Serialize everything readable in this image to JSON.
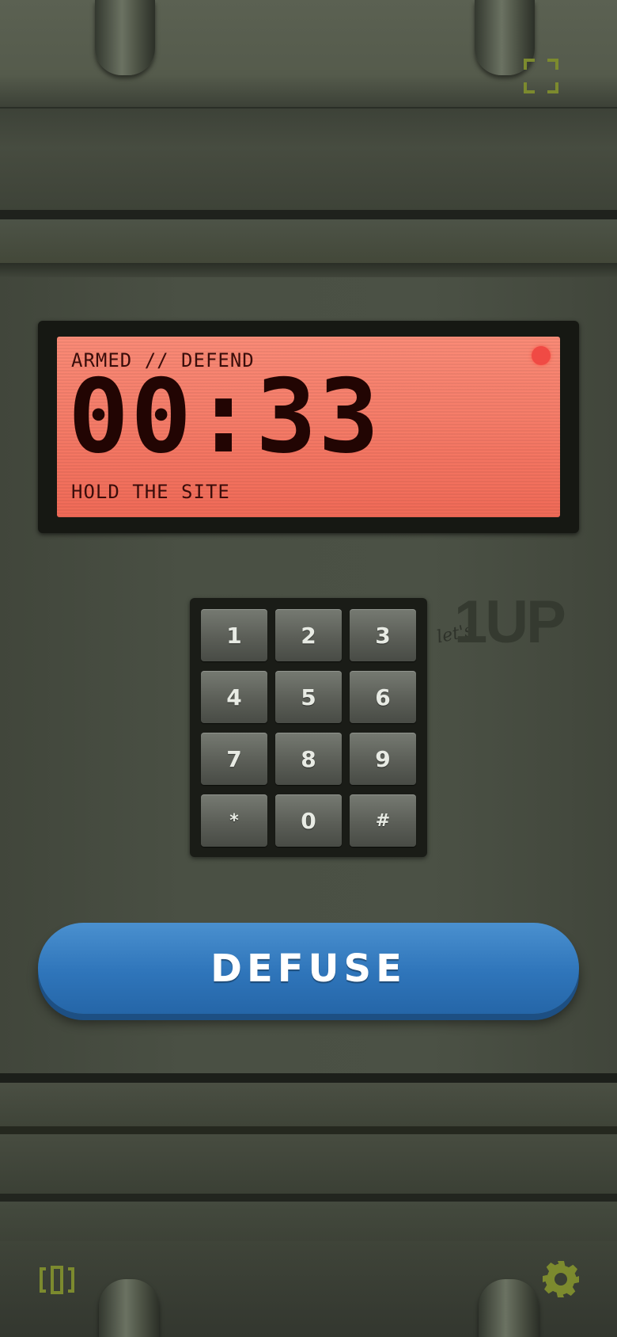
{
  "display": {
    "status": "ARMED // DEFEND",
    "timer": "00:33",
    "hint": "HOLD THE SITE"
  },
  "keypad": {
    "keys": [
      "1",
      "2",
      "3",
      "4",
      "5",
      "6",
      "7",
      "8",
      "9",
      "*",
      "0",
      "#"
    ]
  },
  "logo": {
    "small_text": "let's",
    "big_text": "1UP"
  },
  "actions": {
    "defuse_label": "DEFUSE"
  },
  "icons": {
    "top_right": "fullscreen-icon",
    "bottom_left": "bracket-timeline-icon",
    "bottom_right": "gear-icon"
  },
  "colors": {
    "lcd": "#f37a66",
    "defuse_button": "#2f75ba",
    "icon_accent": "#7c8a2e",
    "status_dot": "#f04a44"
  }
}
